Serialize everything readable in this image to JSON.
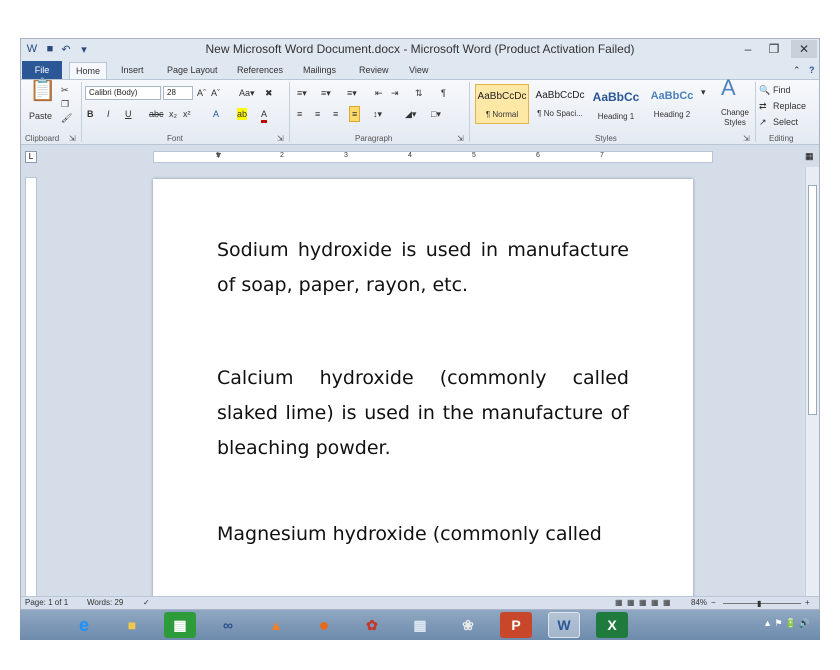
{
  "window": {
    "title": "New Microsoft Word Document.docx  -  Microsoft Word (Product Activation Failed)"
  },
  "tabs": [
    "File",
    "Home",
    "Insert",
    "Page Layout",
    "References",
    "Mailings",
    "Review",
    "View"
  ],
  "ribbon": {
    "clipboard": {
      "paste": "Paste",
      "label": "Clipboard"
    },
    "font": {
      "name": "Calibri (Body)",
      "size": "28",
      "label": "Font"
    },
    "paragraph": {
      "label": "Paragraph"
    },
    "styles": {
      "label": "Styles",
      "items": [
        {
          "sample": "AaBbCcDc",
          "name": "¶ Normal"
        },
        {
          "sample": "AaBbCcDc",
          "name": "¶ No Spaci..."
        },
        {
          "sample": "AaBbCc",
          "name": "Heading 1"
        },
        {
          "sample": "AaBbCc",
          "name": "Heading 2"
        }
      ],
      "change_styles": "Change Styles"
    },
    "editing": {
      "find": "Find",
      "replace": "Replace",
      "select": "Select",
      "label": "Editing"
    }
  },
  "ruler": {
    "numbers": [
      "1",
      "2",
      "3",
      "4",
      "5",
      "6",
      "7"
    ]
  },
  "document": {
    "paragraphs": [
      "Sodium hydroxide is used in manufacture of soap, paper, rayon, etc.",
      "Calcium hydroxide (commonly called slaked lime) is used in the manufacture of bleaching powder.",
      "Magnesium hydroxide (commonly called"
    ]
  },
  "status": {
    "page": "Page: 1 of 1",
    "words": "Words: 29",
    "zoom": "84%"
  },
  "colors": {
    "file_tab": "#2b5797",
    "ribbon": "#e4eaf2",
    "canvas": "#d5dde8"
  }
}
